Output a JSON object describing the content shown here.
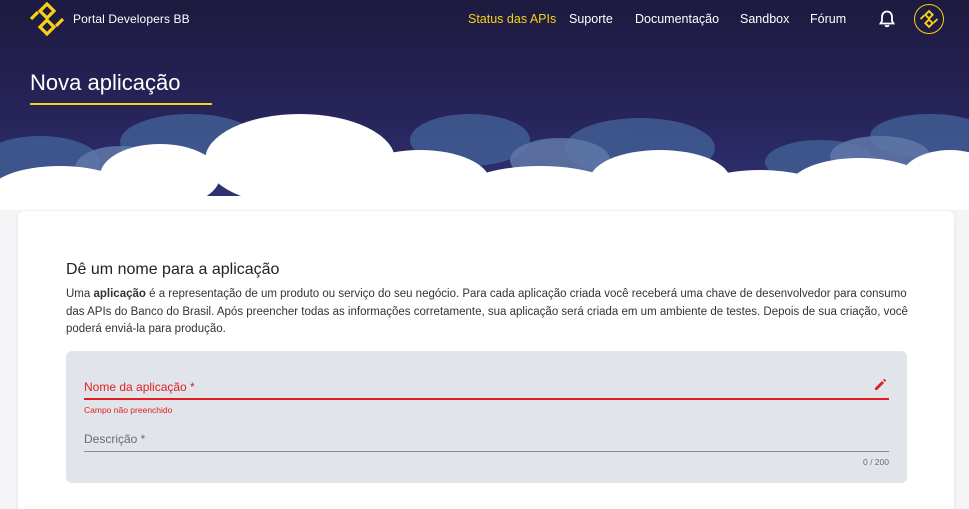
{
  "header": {
    "brand": "Portal Developers BB",
    "nav": [
      {
        "label": "Status das APIs",
        "active": true
      },
      {
        "label": "Suporte",
        "active": false
      },
      {
        "label": "Documentação",
        "active": false
      },
      {
        "label": "Sandbox",
        "active": false
      },
      {
        "label": "Fórum",
        "active": false
      }
    ],
    "icons": {
      "logo": "bb-logo-icon",
      "bell": "bell-icon",
      "avatar": "bb-avatar-icon"
    }
  },
  "page": {
    "title": "Nova aplicação"
  },
  "section": {
    "title": "Dê um nome para a aplicação",
    "desc_pre": "Uma ",
    "desc_bold": "aplicação",
    "desc_post": " é a representação de um produto ou serviço do seu negócio. Para cada aplicação criada você receberá uma chave de desenvolvedor para consumo das APIs do Banco do Brasil. Após preencher todas as informações corretamente, sua aplicação será criada em um ambiente de testes. Depois de sua criação, você poderá enviá-la para produção."
  },
  "form": {
    "name_label": "Nome da aplicação *",
    "name_value": "",
    "name_error": "Campo não preenchido",
    "description_label": "Descrição *",
    "description_value": "",
    "description_counter": "0 / 200"
  },
  "colors": {
    "accent_yellow": "#f8d117",
    "error_red": "#e02020",
    "hero_dark": "#1d1a3f",
    "panel_gray": "#e1e4ea"
  }
}
